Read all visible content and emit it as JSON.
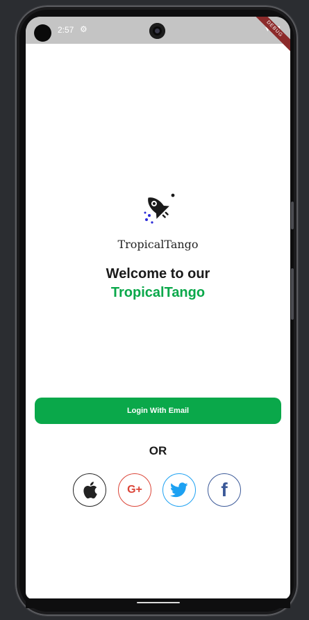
{
  "status_bar": {
    "time": "2:57",
    "gear_icon": "gear-icon",
    "wifi_icon": "wifi-icon",
    "battery_icon": "battery-icon",
    "debug_banner": "DEBUG"
  },
  "header": {
    "logo_icon": "rocket-icon",
    "app_name": "TropicalTango",
    "welcome_text": "Welcome to our",
    "brand_text": "TropicalTango"
  },
  "actions": {
    "login_email_label": "Login With Email",
    "or_label": "OR"
  },
  "social_login": [
    {
      "name": "apple",
      "icon": "apple-icon",
      "color": "#222222"
    },
    {
      "name": "google",
      "icon": "google-plus-icon",
      "label": "G+",
      "color": "#db4437"
    },
    {
      "name": "twitter",
      "icon": "twitter-icon",
      "color": "#1da1f2"
    },
    {
      "name": "facebook",
      "icon": "facebook-icon",
      "label": "f",
      "color": "#3b5998"
    }
  ],
  "colors": {
    "accent": "#0aa84a",
    "status_bar": "#c4c4c4"
  }
}
